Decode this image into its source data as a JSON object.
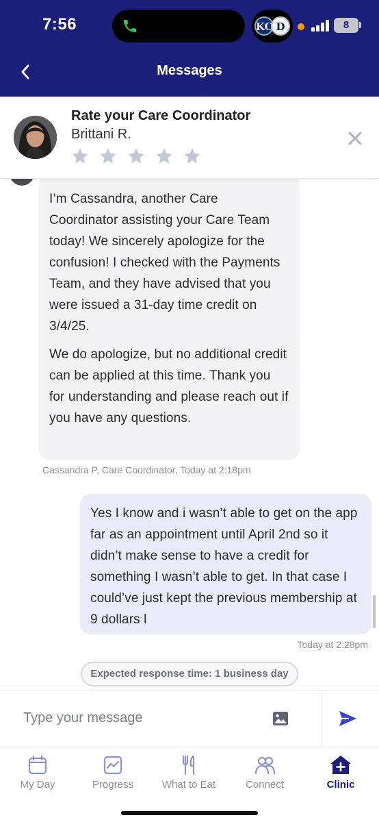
{
  "status_bar": {
    "time": "7:56",
    "battery": "8",
    "live_activity_teams": [
      "KC",
      "D"
    ]
  },
  "header": {
    "title": "Messages",
    "back_icon": "chevron-left-icon"
  },
  "rating": {
    "title": "Rate your Care Coordinator",
    "coordinator_name": "Brittani R.",
    "stars_total": 5,
    "stars_selected": 0
  },
  "messages": [
    {
      "direction": "incoming",
      "paragraphs": [
        "I’m Cassandra, another Care Coordinator assisting your Care Team today! We sincerely apologize for the confusion! I checked with the Payments Team, and they have advised that you were issued a 31-day time credit on 3/4/25.",
        "We do apologize, but no additional credit can be applied at this time. Thank you for understanding and please reach out if you have any questions."
      ],
      "sender": "Cassandra P, Care Coordinator,",
      "timestamp": "Today at 2:18pm"
    },
    {
      "direction": "outgoing",
      "text": "Yes I know and i wasn’t able to get on the app far as an appointment until April 2nd so it didn’t make sense to have a credit for something I wasn’t able to get. In that case I could’ve just kept the previous membership at 9 dollars l",
      "timestamp": "Today at 2:28pm"
    }
  ],
  "response_time_notice": "Expected response time: 1 business day",
  "composer": {
    "placeholder": "Type your message"
  },
  "tabs": [
    {
      "label": "My Day",
      "icon": "calendar-icon",
      "active": false
    },
    {
      "label": "Progress",
      "icon": "chart-icon",
      "active": false
    },
    {
      "label": "What to Eat",
      "icon": "utensils-icon",
      "active": false
    },
    {
      "label": "Connect",
      "icon": "people-icon",
      "active": false
    },
    {
      "label": "Clinic",
      "icon": "clinic-icon",
      "active": true
    }
  ],
  "colors": {
    "brand_navy": "#1b1f7a",
    "incoming_bubble": "#f3f3f5",
    "outgoing_bubble": "#e9ebfa",
    "star_empty": "#c3c8d6"
  }
}
